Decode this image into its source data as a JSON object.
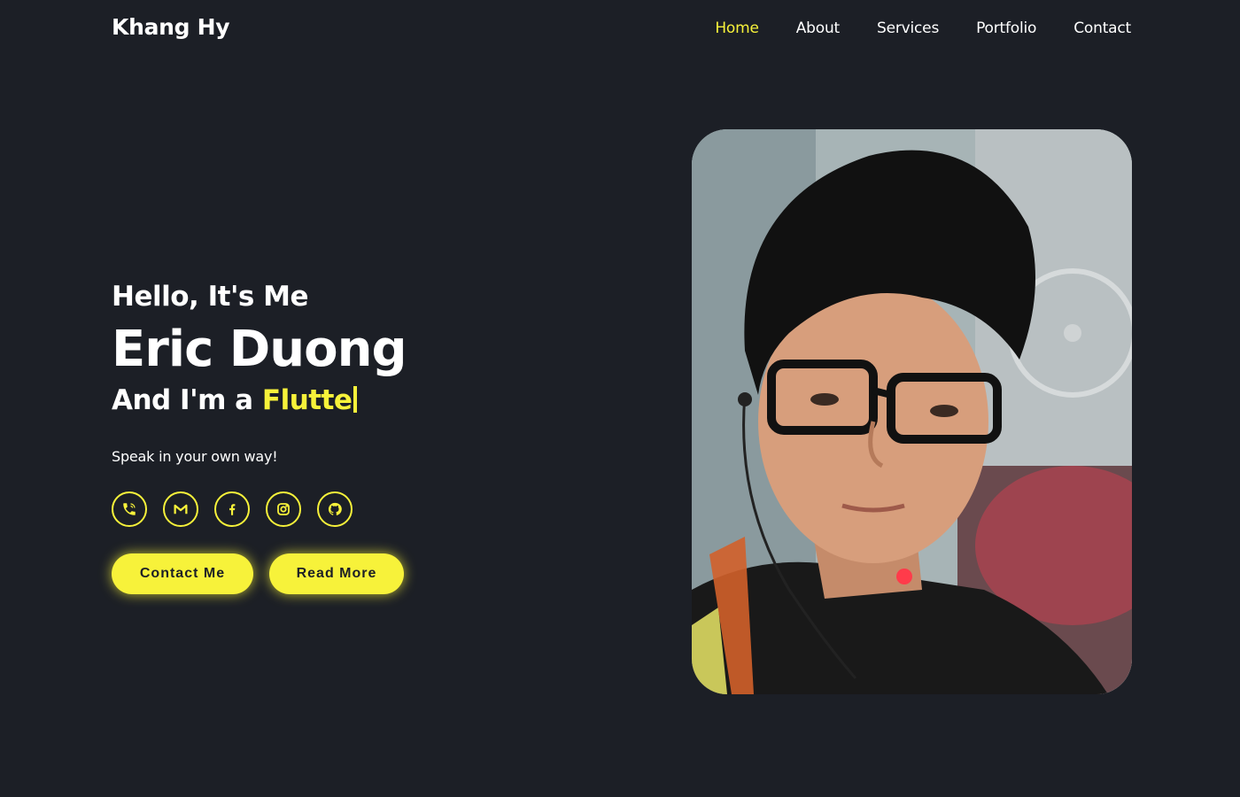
{
  "header": {
    "logo": "Khang Hy",
    "nav": [
      {
        "label": "Home",
        "active": true
      },
      {
        "label": "About",
        "active": false
      },
      {
        "label": "Services",
        "active": false
      },
      {
        "label": "Portfolio",
        "active": false
      },
      {
        "label": "Contact",
        "active": false
      }
    ]
  },
  "hero": {
    "greeting": "Hello, It's Me",
    "name": "Eric Duong",
    "role_prefix": "And I'm a",
    "role_typed": "Flutte",
    "tagline": "Speak in your own way!",
    "socials": [
      {
        "icon": "phone-icon"
      },
      {
        "icon": "gmail-icon"
      },
      {
        "icon": "facebook-icon"
      },
      {
        "icon": "instagram-icon"
      },
      {
        "icon": "github-icon"
      }
    ],
    "buttons": {
      "contact": "Contact Me",
      "read_more": "Read More"
    }
  },
  "portrait": {
    "subject": "profile-photo"
  },
  "colors": {
    "background": "#1c1f26",
    "accent": "#f7f23a",
    "text": "#ffffff"
  }
}
